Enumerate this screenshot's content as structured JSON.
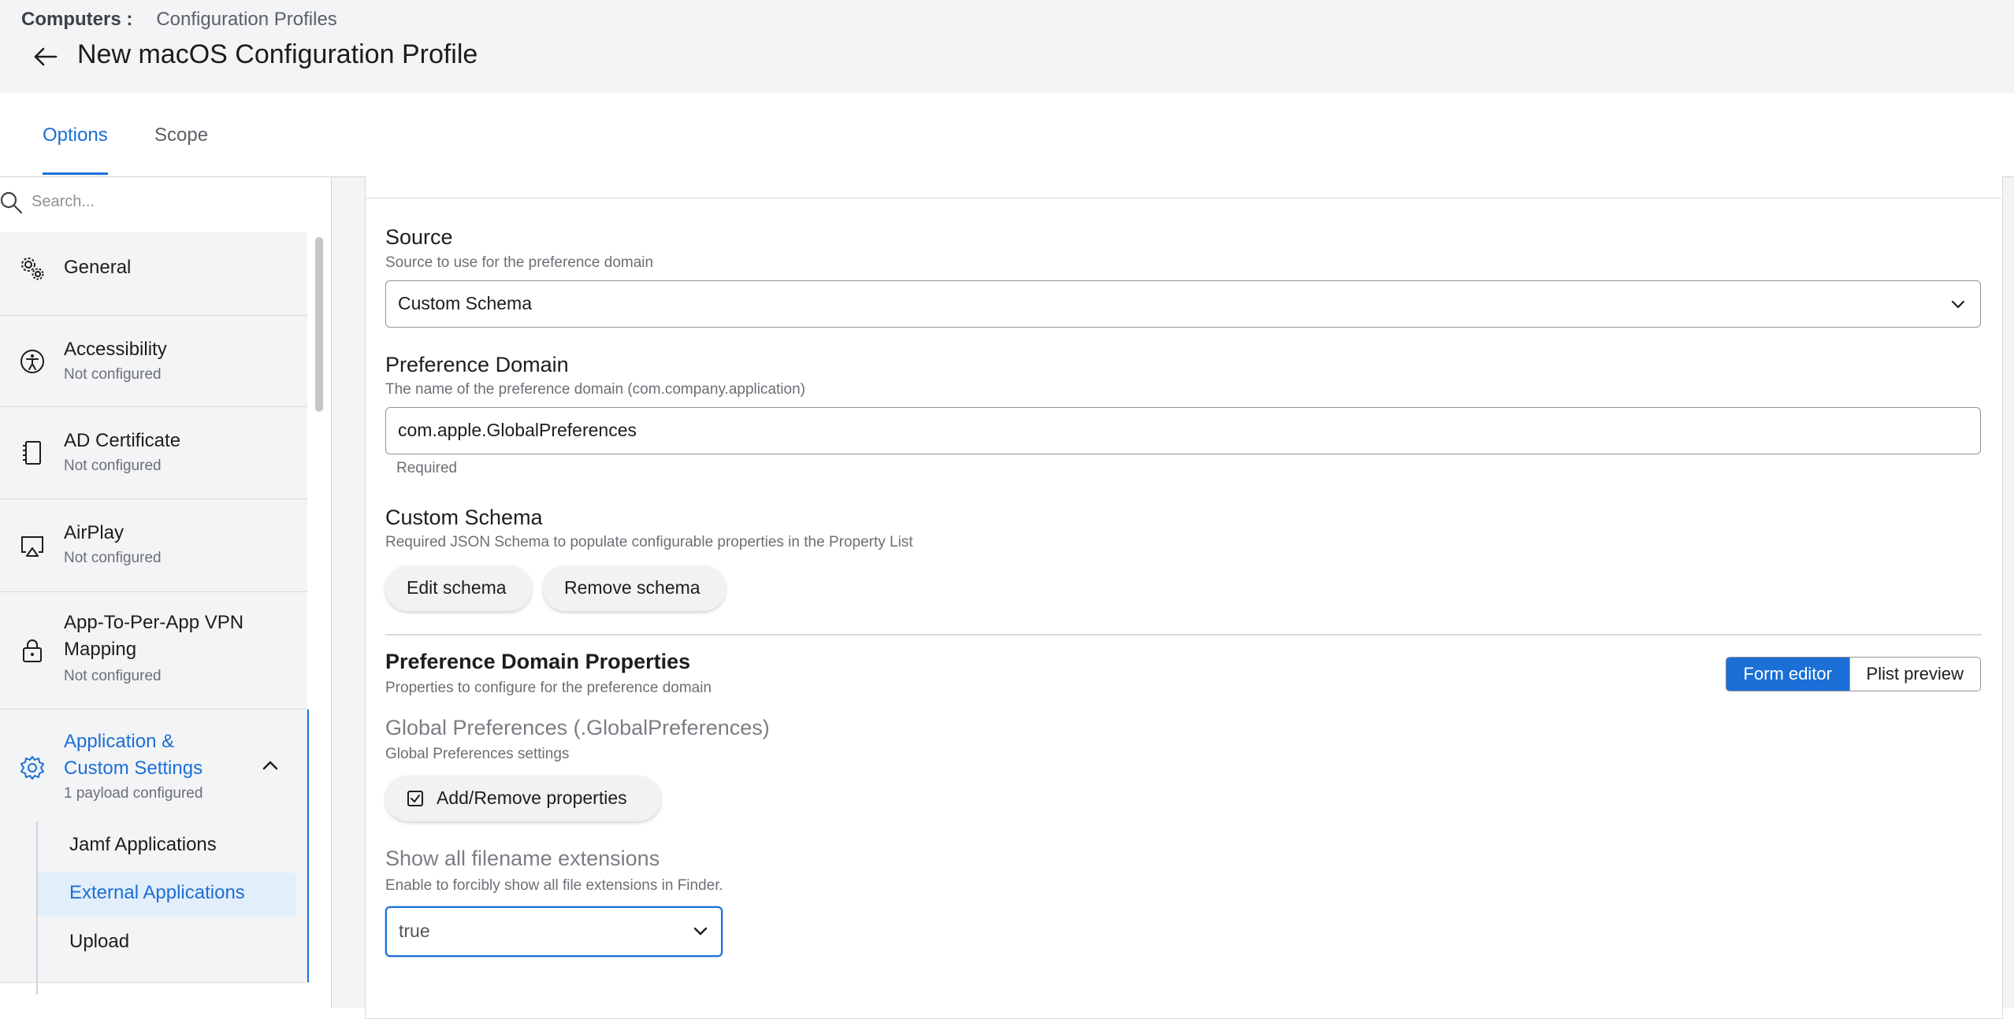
{
  "breadcrumb": {
    "parent": "Computers :",
    "current": "Configuration Profiles"
  },
  "page_title": "New macOS Configuration Profile",
  "tabs": [
    {
      "label": "Options",
      "active": true
    },
    {
      "label": "Scope",
      "active": false
    }
  ],
  "search": {
    "placeholder": "Search..."
  },
  "sidebar": {
    "items": [
      {
        "label": "General",
        "sub": "",
        "icon": "gears-icon"
      },
      {
        "label": "Accessibility",
        "sub": "Not configured",
        "icon": "accessibility-icon"
      },
      {
        "label": "AD Certificate",
        "sub": "Not configured",
        "icon": "certificate-icon"
      },
      {
        "label": "AirPlay",
        "sub": "Not configured",
        "icon": "airplay-icon"
      },
      {
        "label": "App-To-Per-App VPN",
        "label2": "Mapping",
        "sub": "Not configured",
        "icon": "lock-icon"
      },
      {
        "label": "Application &",
        "label2": "Custom Settings",
        "sub": "1 payload configured",
        "icon": "gear-icon"
      }
    ],
    "subitems": [
      "Jamf Applications",
      "External Applications",
      "Upload"
    ]
  },
  "form": {
    "source": {
      "label": "Source",
      "help": "Source to use for the preference domain",
      "value": "Custom Schema"
    },
    "domain": {
      "label": "Preference Domain",
      "help": "The name of the preference domain (com.company.application)",
      "value": "com.apple.GlobalPreferences",
      "required": "Required"
    },
    "schema": {
      "label": "Custom Schema",
      "help": "Required JSON Schema to populate configurable properties in the Property List",
      "edit": "Edit schema",
      "remove": "Remove schema"
    },
    "properties": {
      "label": "Preference Domain Properties",
      "help": "Properties to configure for the preference domain",
      "form_editor": "Form editor",
      "plist_preview": "Plist preview",
      "group_title": "Global Preferences (.GlobalPreferences)",
      "group_help": "Global Preferences settings",
      "add_remove": "Add/Remove properties",
      "field_label": "Show all filename extensions",
      "field_help": "Enable to forcibly show all file extensions in Finder.",
      "field_value": "true"
    }
  },
  "colors": {
    "accent": "#1b6fd6",
    "background": "#f3f4f6"
  }
}
